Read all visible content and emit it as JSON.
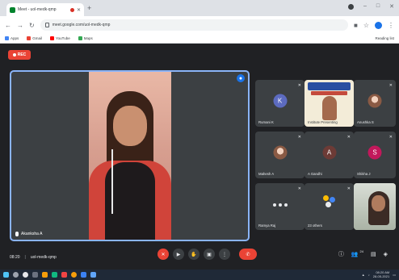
{
  "browser": {
    "tab_title": "Meet - uol-medk-qmp",
    "new_tab_symbol": "+",
    "url": "meet.google.com/uol-medk-qmp",
    "bookmarks": [
      {
        "label": "Apps",
        "color": "#4285f4"
      },
      {
        "label": "Gmail",
        "color": "#ea4335"
      },
      {
        "label": "YouTube",
        "color": "#ff0000"
      },
      {
        "label": "Maps",
        "color": "#34a853"
      }
    ],
    "reading_list": "Reading list"
  },
  "meet": {
    "recording_label": "REC",
    "main_participant": "Akanksha A",
    "participants": [
      {
        "name": "Rumani K",
        "initial": "K",
        "color": "#5c6bc0",
        "kind": "avatar"
      },
      {
        "name": "Institute Presenting",
        "kind": "share"
      },
      {
        "name": "Anushka S",
        "kind": "photo"
      },
      {
        "name": "Mahesh A",
        "kind": "photo"
      },
      {
        "name": "A Gandhi",
        "initial": "A",
        "color": "#6d3b36",
        "kind": "avatar"
      },
      {
        "name": "Shikha J",
        "initial": "S",
        "color": "#c2185b",
        "kind": "avatar"
      },
      {
        "name": "Ramya Raj",
        "kind": "dots"
      },
      {
        "name": "23 others",
        "kind": "logo"
      },
      {
        "name": "",
        "kind": "camera"
      }
    ],
    "meeting_time": "08:20",
    "meeting_code": "uol-medk-qmp",
    "participant_count": "24"
  },
  "taskbar": {
    "time": "08:20 AM",
    "date": "28-05-2021"
  }
}
